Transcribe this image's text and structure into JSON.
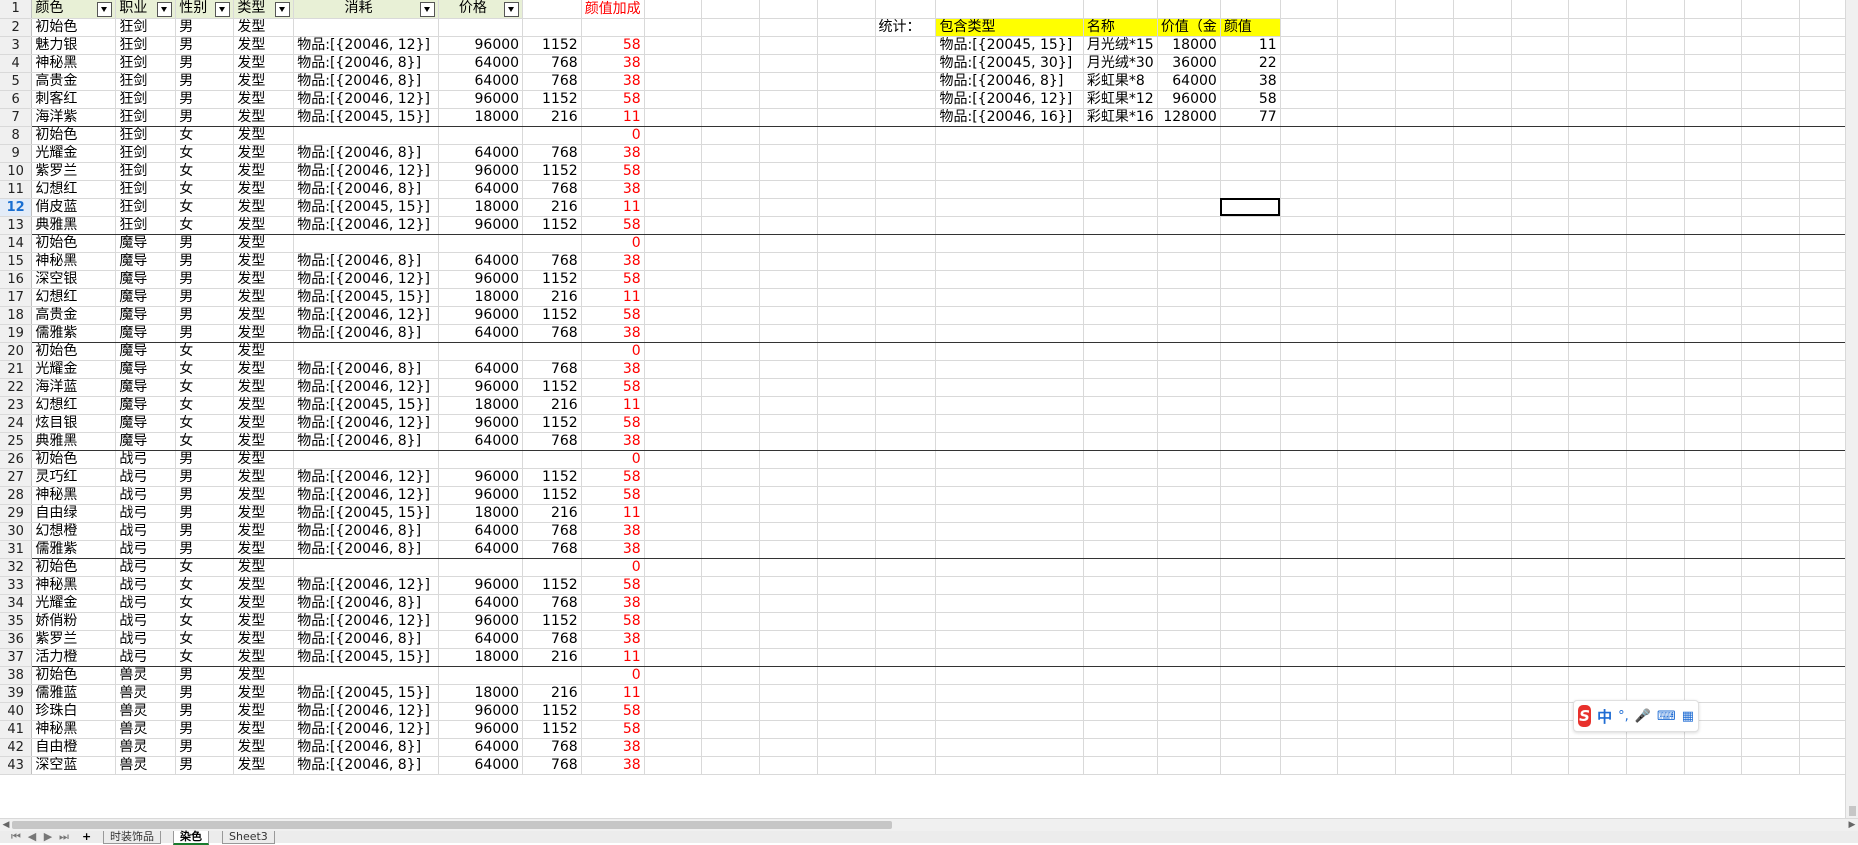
{
  "sheet": {
    "headers": {
      "color": "颜色",
      "job": "职业",
      "gender": "性别",
      "type": "类型",
      "cost": "消耗",
      "price": "价格",
      "bonus": "颜值加成"
    },
    "rows": [
      {
        "r": "2",
        "c": "初始色",
        "j": "狂剑",
        "g": "男",
        "t": "发型",
        "cost": "",
        "p": "",
        "h": "",
        "b": "",
        "grp": false
      },
      {
        "r": "3",
        "c": "魅力银",
        "j": "狂剑",
        "g": "男",
        "t": "发型",
        "cost": "物品:[{20046, 12}]",
        "p": "96000",
        "h": "1152",
        "b": "58",
        "grp": false
      },
      {
        "r": "4",
        "c": "神秘黑",
        "j": "狂剑",
        "g": "男",
        "t": "发型",
        "cost": " 物品:[{20046, 8}]",
        "p": "64000",
        "h": "768",
        "b": "38",
        "grp": false
      },
      {
        "r": "5",
        "c": "高贵金",
        "j": "狂剑",
        "g": "男",
        "t": "发型",
        "cost": " 物品:[{20046, 8}]",
        "p": "64000",
        "h": "768",
        "b": "38",
        "grp": false
      },
      {
        "r": "6",
        "c": "刺客红",
        "j": "狂剑",
        "g": "男",
        "t": "发型",
        "cost": "物品:[{20046, 12}]",
        "p": "96000",
        "h": "1152",
        "b": "58",
        "grp": false
      },
      {
        "r": "7",
        "c": "海洋紫",
        "j": "狂剑",
        "g": "男",
        "t": "发型",
        "cost": "物品:[{20045, 15}]",
        "p": "18000",
        "h": "216",
        "b": "11",
        "grp": true
      },
      {
        "r": "8",
        "c": "初始色",
        "j": "狂剑",
        "g": "女",
        "t": "发型",
        "cost": "",
        "p": "",
        "h": "",
        "b": "0",
        "grp": false
      },
      {
        "r": "9",
        "c": "光耀金",
        "j": "狂剑",
        "g": "女",
        "t": "发型",
        "cost": " 物品:[{20046, 8}]",
        "p": "64000",
        "h": "768",
        "b": "38",
        "grp": false
      },
      {
        "r": "10",
        "c": "紫罗兰",
        "j": "狂剑",
        "g": "女",
        "t": "发型",
        "cost": "物品:[{20046, 12}]",
        "p": "96000",
        "h": "1152",
        "b": "58",
        "grp": false
      },
      {
        "r": "11",
        "c": "幻想红",
        "j": "狂剑",
        "g": "女",
        "t": "发型",
        "cost": " 物品:[{20046, 8}]",
        "p": "64000",
        "h": "768",
        "b": "38",
        "grp": false
      },
      {
        "r": "12",
        "c": "俏皮蓝",
        "j": "狂剑",
        "g": "女",
        "t": "发型",
        "cost": "物品:[{20045, 15}]",
        "p": "18000",
        "h": "216",
        "b": "11",
        "grp": false
      },
      {
        "r": "13",
        "c": "典雅黑",
        "j": "狂剑",
        "g": "女",
        "t": "发型",
        "cost": "物品:[{20046, 12}]",
        "p": "96000",
        "h": "1152",
        "b": "58",
        "grp": true
      },
      {
        "r": "14",
        "c": "初始色",
        "j": "魔导",
        "g": "男",
        "t": "发型",
        "cost": "",
        "p": "",
        "h": "",
        "b": "0",
        "grp": false
      },
      {
        "r": "15",
        "c": "神秘黑",
        "j": "魔导",
        "g": "男",
        "t": "发型",
        "cost": " 物品:[{20046, 8}]",
        "p": "64000",
        "h": "768",
        "b": "38",
        "grp": false
      },
      {
        "r": "16",
        "c": "深空银",
        "j": "魔导",
        "g": "男",
        "t": "发型",
        "cost": "物品:[{20046, 12}]",
        "p": "96000",
        "h": "1152",
        "b": "58",
        "grp": false
      },
      {
        "r": "17",
        "c": "幻想红",
        "j": "魔导",
        "g": "男",
        "t": "发型",
        "cost": "物品:[{20045, 15}]",
        "p": "18000",
        "h": "216",
        "b": "11",
        "grp": false
      },
      {
        "r": "18",
        "c": "高贵金",
        "j": "魔导",
        "g": "男",
        "t": "发型",
        "cost": "物品:[{20046, 12}]",
        "p": "96000",
        "h": "1152",
        "b": "58",
        "grp": false
      },
      {
        "r": "19",
        "c": "儒雅紫",
        "j": "魔导",
        "g": "男",
        "t": "发型",
        "cost": " 物品:[{20046, 8}]",
        "p": "64000",
        "h": "768",
        "b": "38",
        "grp": true
      },
      {
        "r": "20",
        "c": "初始色",
        "j": "魔导",
        "g": "女",
        "t": "发型",
        "cost": "",
        "p": "",
        "h": "",
        "b": "0",
        "grp": false
      },
      {
        "r": "21",
        "c": "光耀金",
        "j": "魔导",
        "g": "女",
        "t": "发型",
        "cost": " 物品:[{20046, 8}]",
        "p": "64000",
        "h": "768",
        "b": "38",
        "grp": false
      },
      {
        "r": "22",
        "c": "海洋蓝",
        "j": "魔导",
        "g": "女",
        "t": "发型",
        "cost": "物品:[{20046, 12}]",
        "p": "96000",
        "h": "1152",
        "b": "58",
        "grp": false
      },
      {
        "r": "23",
        "c": "幻想红",
        "j": "魔导",
        "g": "女",
        "t": "发型",
        "cost": "物品:[{20045, 15}]",
        "p": "18000",
        "h": "216",
        "b": "11",
        "grp": false
      },
      {
        "r": "24",
        "c": "炫目银",
        "j": "魔导",
        "g": "女",
        "t": "发型",
        "cost": "物品:[{20046, 12}]",
        "p": "96000",
        "h": "1152",
        "b": "58",
        "grp": false
      },
      {
        "r": "25",
        "c": "典雅黑",
        "j": "魔导",
        "g": "女",
        "t": "发型",
        "cost": " 物品:[{20046, 8}]",
        "p": "64000",
        "h": "768",
        "b": "38",
        "grp": true
      },
      {
        "r": "26",
        "c": "初始色",
        "j": "战弓",
        "g": "男",
        "t": "发型",
        "cost": "",
        "p": "",
        "h": "",
        "b": "0",
        "grp": false
      },
      {
        "r": "27",
        "c": "灵巧红",
        "j": "战弓",
        "g": "男",
        "t": "发型",
        "cost": "物品:[{20046, 12}]",
        "p": "96000",
        "h": "1152",
        "b": "58",
        "grp": false
      },
      {
        "r": "28",
        "c": "神秘黑",
        "j": "战弓",
        "g": "男",
        "t": "发型",
        "cost": "物品:[{20046, 12}]",
        "p": "96000",
        "h": "1152",
        "b": "58",
        "grp": false
      },
      {
        "r": "29",
        "c": "自由绿",
        "j": "战弓",
        "g": "男",
        "t": "发型",
        "cost": "物品:[{20045, 15}]",
        "p": "18000",
        "h": "216",
        "b": "11",
        "grp": false
      },
      {
        "r": "30",
        "c": "幻想橙",
        "j": "战弓",
        "g": "男",
        "t": "发型",
        "cost": " 物品:[{20046, 8}]",
        "p": "64000",
        "h": "768",
        "b": "38",
        "grp": false
      },
      {
        "r": "31",
        "c": "儒雅紫",
        "j": "战弓",
        "g": "男",
        "t": "发型",
        "cost": " 物品:[{20046, 8}]",
        "p": "64000",
        "h": "768",
        "b": "38",
        "grp": true
      },
      {
        "r": "32",
        "c": "初始色",
        "j": "战弓",
        "g": "女",
        "t": "发型",
        "cost": "",
        "p": "",
        "h": "",
        "b": "0",
        "grp": false
      },
      {
        "r": "33",
        "c": "神秘黑",
        "j": "战弓",
        "g": "女",
        "t": "发型",
        "cost": "物品:[{20046, 12}]",
        "p": "96000",
        "h": "1152",
        "b": "58",
        "grp": false
      },
      {
        "r": "34",
        "c": "光耀金",
        "j": "战弓",
        "g": "女",
        "t": "发型",
        "cost": " 物品:[{20046, 8}]",
        "p": "64000",
        "h": "768",
        "b": "38",
        "grp": false
      },
      {
        "r": "35",
        "c": "娇俏粉",
        "j": "战弓",
        "g": "女",
        "t": "发型",
        "cost": "物品:[{20046, 12}]",
        "p": "96000",
        "h": "1152",
        "b": "58",
        "grp": false
      },
      {
        "r": "36",
        "c": "紫罗兰",
        "j": "战弓",
        "g": "女",
        "t": "发型",
        "cost": " 物品:[{20046, 8}]",
        "p": "64000",
        "h": "768",
        "b": "38",
        "grp": false
      },
      {
        "r": "37",
        "c": "活力橙",
        "j": "战弓",
        "g": "女",
        "t": "发型",
        "cost": "物品:[{20045, 15}]",
        "p": "18000",
        "h": "216",
        "b": "11",
        "grp": true
      },
      {
        "r": "38",
        "c": "初始色",
        "j": "兽灵",
        "g": "男",
        "t": "发型",
        "cost": "",
        "p": "",
        "h": "",
        "b": "0",
        "grp": false
      },
      {
        "r": "39",
        "c": "儒雅蓝",
        "j": "兽灵",
        "g": "男",
        "t": "发型",
        "cost": "物品:[{20045, 15}]",
        "p": "18000",
        "h": "216",
        "b": "11",
        "grp": false
      },
      {
        "r": "40",
        "c": "珍珠白",
        "j": "兽灵",
        "g": "男",
        "t": "发型",
        "cost": "物品:[{20046, 12}]",
        "p": "96000",
        "h": "1152",
        "b": "58",
        "grp": false
      },
      {
        "r": "41",
        "c": "神秘黑",
        "j": "兽灵",
        "g": "男",
        "t": "发型",
        "cost": "物品:[{20046, 12}]",
        "p": "96000",
        "h": "1152",
        "b": "58",
        "grp": false
      },
      {
        "r": "42",
        "c": "自由橙",
        "j": "兽灵",
        "g": "男",
        "t": "发型",
        "cost": " 物品:[{20046, 8}]",
        "p": "64000",
        "h": "768",
        "b": "38",
        "grp": false
      },
      {
        "r": "43",
        "c": "深空蓝",
        "j": "兽灵",
        "g": "男",
        "t": "发型",
        "cost": " 物品:[{20046, 8}]",
        "p": "64000",
        "h": "768",
        "b": "38",
        "grp": false
      }
    ]
  },
  "stats": {
    "label": "统计：",
    "headers": {
      "contains": "包含类型",
      "name": "名称",
      "value": "价值（金",
      "beauty": "颜值"
    },
    "rows": [
      {
        "contains": "物品:[{20045, 15}]",
        "name": "月光绒*15",
        "value": "18000",
        "beauty": "11"
      },
      {
        "contains": "物品:[{20045, 30}]",
        "name": "月光绒*30",
        "value": "36000",
        "beauty": "22"
      },
      {
        "contains": "物品:[{20046, 8}]",
        "name": "彩虹果*8",
        "value": "64000",
        "beauty": "38"
      },
      {
        "contains": "物品:[{20046, 12}]",
        "name": "彩虹果*12",
        "value": "96000",
        "beauty": "58"
      },
      {
        "contains": "物品:[{20046, 16}]",
        "name": "彩虹果*16",
        "value": "128000",
        "beauty": "77"
      }
    ]
  },
  "header_row_number": "1",
  "selected_row": "12",
  "tabs": [
    {
      "label": "时装饰品",
      "active": false
    },
    {
      "label": "染色",
      "active": true
    },
    {
      "label": "Sheet3",
      "active": false
    }
  ],
  "tab_add": "+",
  "ime": {
    "brand": "S",
    "mode": "中",
    "punct": "°,",
    "mic": "🎤",
    "keyboard": "⌨",
    "grid": "▦"
  },
  "colors": {
    "header_fill": "#e8f0d6",
    "stats_header_fill": "#ffff00",
    "bonus_text": "#ff0000",
    "selected_row_text": "#1a6fd1"
  }
}
